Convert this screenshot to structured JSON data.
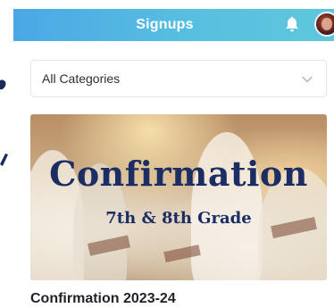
{
  "header": {
    "title": "Signups",
    "bell_icon": "bell-icon",
    "avatar_icon": "user-avatar"
  },
  "filter": {
    "selected": "All Categories",
    "chevron_icon": "chevron-down-icon"
  },
  "card": {
    "image_title": "Confirmation",
    "image_subtitle": "7th & 8th Grade",
    "title": "Confirmation 2023-24"
  },
  "colors": {
    "header_start": "#4aa8e6",
    "header_end": "#5fc7db",
    "banner_text": "#1b2d63"
  }
}
